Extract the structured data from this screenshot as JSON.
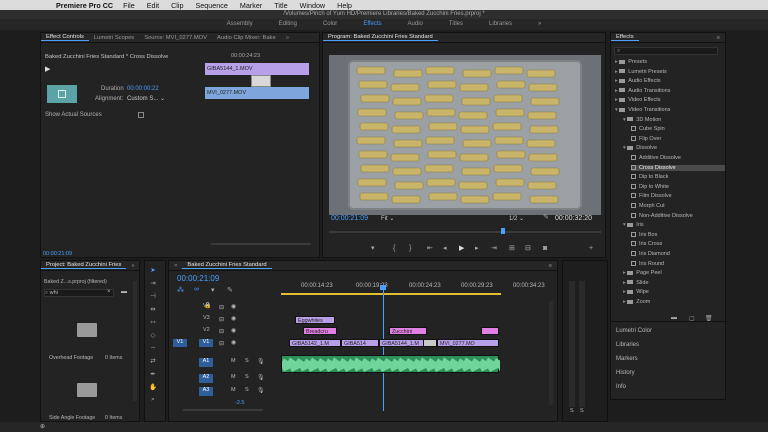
{
  "menubar": {
    "apple": "",
    "app_name": "Premiere Pro CC",
    "items": [
      "File",
      "Edit",
      "Clip",
      "Sequence",
      "Marker",
      "Title",
      "Window",
      "Help"
    ]
  },
  "title": "/Volumes/Pinch of Yum HD/Premiere Libraries/Baked Zucchini Fries.prproj *",
  "workspaces": [
    "Assembly",
    "Editing",
    "Color",
    "Effects",
    "Audio",
    "Titles",
    "Libraries"
  ],
  "workspace_more": "»",
  "active_workspace": "Effects",
  "effect_controls": {
    "tabs": [
      "Effect Controls",
      "Lumetri Scopes",
      "Source: MVI_0277.MOV",
      "Audio Clip Mixer: Bake"
    ],
    "more": "»",
    "header": "Baked Zucchini Fries Standard * Cross Dissolve",
    "timecode_top": "00:00:24:23",
    "clip_a": "GIBA5144_1.MOV",
    "clip_b": "MVI_0277.MOV",
    "duration_label": "Duration",
    "duration_value": "00:00:00:22",
    "alignment_label": "Alignment:",
    "alignment_value": "Custom S...",
    "show_actual_sources": "Show Actual Sources",
    "bottom_timecode": "00:00:21:09"
  },
  "program": {
    "title": "Program: Baked Zucchini Fries Standard",
    "timecode": "00:00:21:09",
    "fit": "Fit",
    "resolution": "1/2",
    "duration": "00:00:32:20"
  },
  "effects_panel": {
    "title": "Effects",
    "items": [
      {
        "label": "Presets",
        "level": 0,
        "type": "folder"
      },
      {
        "label": "Lumetri Presets",
        "level": 0,
        "type": "folder"
      },
      {
        "label": "Audio Effects",
        "level": 0,
        "type": "folder"
      },
      {
        "label": "Audio Transitions",
        "level": 0,
        "type": "folder"
      },
      {
        "label": "Video Effects",
        "level": 0,
        "type": "folder"
      },
      {
        "label": "Video Transitions",
        "level": 0,
        "type": "folder"
      },
      {
        "label": "3D Motion",
        "level": 1,
        "type": "folder"
      },
      {
        "label": "Cube Spin",
        "level": 2,
        "type": "fx"
      },
      {
        "label": "Flip Over",
        "level": 2,
        "type": "fx"
      },
      {
        "label": "Dissolve",
        "level": 1,
        "type": "folder"
      },
      {
        "label": "Additive Dissolve",
        "level": 2,
        "type": "fx"
      },
      {
        "label": "Cross Dissolve",
        "level": 2,
        "type": "fx",
        "selected": true
      },
      {
        "label": "Dip to Black",
        "level": 2,
        "type": "fx"
      },
      {
        "label": "Dip to White",
        "level": 2,
        "type": "fx"
      },
      {
        "label": "Film Dissolve",
        "level": 2,
        "type": "fx"
      },
      {
        "label": "Morph Cut",
        "level": 2,
        "type": "fx"
      },
      {
        "label": "Non-Additive Dissolve",
        "level": 2,
        "type": "fx"
      },
      {
        "label": "Iris",
        "level": 1,
        "type": "folder"
      },
      {
        "label": "Iris Box",
        "level": 2,
        "type": "fx"
      },
      {
        "label": "Iris Cross",
        "level": 2,
        "type": "fx"
      },
      {
        "label": "Iris Diamond",
        "level": 2,
        "type": "fx"
      },
      {
        "label": "Iris Round",
        "level": 2,
        "type": "fx"
      },
      {
        "label": "Page Peel",
        "level": 1,
        "type": "folder"
      },
      {
        "label": "Slide",
        "level": 1,
        "type": "folder"
      },
      {
        "label": "Wipe",
        "level": 1,
        "type": "folder"
      },
      {
        "label": "Zoom",
        "level": 1,
        "type": "folder"
      }
    ],
    "bottom_panels": [
      "Lumetri Color",
      "Libraries",
      "Markers",
      "History",
      "Info"
    ]
  },
  "project": {
    "title": "Project: Baked Zucchini Fries",
    "more": "»",
    "file": "Baked Z...s.prproj (filtered)",
    "search_value": "whi",
    "bins": [
      {
        "name": "Overhead Footage",
        "count": "0 Items"
      },
      {
        "name": "Side Angle Footage",
        "count": "0 Items"
      }
    ]
  },
  "timeline": {
    "title": "Baked Zucchini Fries Standard",
    "timecode": "00:00:21:09",
    "ruler": [
      "00:00:14:23",
      "00:00:19:23",
      "00:00:24:23",
      "00:00:29:23",
      "00:00:34:23"
    ],
    "video_tracks": [
      "V4",
      "V3",
      "V2",
      "V1"
    ],
    "audio_tracks": [
      "A1",
      "A2",
      "A3"
    ],
    "source_v1": "V1",
    "track_m": "M",
    "track_s": "S",
    "clips_v3": "Eggwhites",
    "clips_v2": [
      "Breadcru",
      "Zucchini"
    ],
    "clips_v1": [
      "GIBA5142_1.M",
      "GIBA514",
      "GIBA5144_1.M",
      "MVI_0277.MO"
    ],
    "master_value": "-2.5",
    "meter_labels": [
      "S",
      "S"
    ]
  },
  "colors": {
    "accent": "#4a9fff",
    "clip_purple": "#b8a0e8",
    "clip_pink": "#e27fe2",
    "audio_green": "#2f8f5a"
  }
}
